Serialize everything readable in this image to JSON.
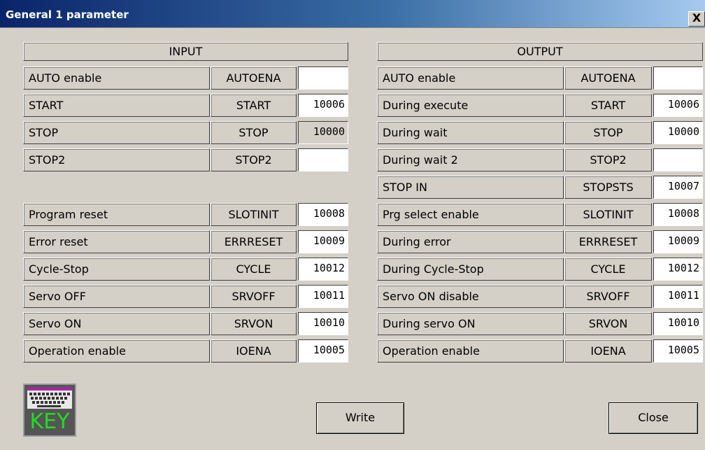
{
  "window": {
    "title": "General 1 parameter",
    "close_glyph": "X"
  },
  "input": {
    "header": "INPUT",
    "rows": [
      {
        "label": "AUTO enable",
        "code": "AUTOENA",
        "value": "",
        "readonly": false
      },
      {
        "label": "START",
        "code": "START",
        "value": "10006",
        "readonly": false
      },
      {
        "label": "STOP",
        "code": "STOP",
        "value": "10000",
        "readonly": true
      },
      {
        "label": "STOP2",
        "code": "STOP2",
        "value": "",
        "readonly": false
      },
      {
        "label": "Program reset",
        "code": "SLOTINIT",
        "value": "10008",
        "readonly": false
      },
      {
        "label": "Error reset",
        "code": "ERRRESET",
        "value": "10009",
        "readonly": false
      },
      {
        "label": "Cycle-Stop",
        "code": "CYCLE",
        "value": "10012",
        "readonly": false
      },
      {
        "label": "Servo OFF",
        "code": "SRVOFF",
        "value": "10011",
        "readonly": false
      },
      {
        "label": "Servo ON",
        "code": "SRVON",
        "value": "10010",
        "readonly": false
      },
      {
        "label": "Operation enable",
        "code": "IOENA",
        "value": "10005",
        "readonly": false
      }
    ]
  },
  "output": {
    "header": "OUTPUT",
    "rows": [
      {
        "label": "AUTO enable",
        "code": "AUTOENA",
        "value": ""
      },
      {
        "label": "During execute",
        "code": "START",
        "value": "10006"
      },
      {
        "label": "During wait",
        "code": "STOP",
        "value": "10000"
      },
      {
        "label": "During wait 2",
        "code": "STOP2",
        "value": ""
      },
      {
        "label": "STOP IN",
        "code": "STOPSTS",
        "value": "10007"
      },
      {
        "label": "Prg select enable",
        "code": "SLOTINIT",
        "value": "10008"
      },
      {
        "label": "During error",
        "code": "ERRRESET",
        "value": "10009"
      },
      {
        "label": "During Cycle-Stop",
        "code": "CYCLE",
        "value": "10012"
      },
      {
        "label": "Servo ON disable",
        "code": "SRVOFF",
        "value": "10011"
      },
      {
        "label": "During servo ON",
        "code": "SRVON",
        "value": "10010"
      },
      {
        "label": "Operation enable",
        "code": "IOENA",
        "value": "10005"
      }
    ]
  },
  "key_button": {
    "text": "KEY",
    "icon": "keyboard-icon",
    "text_color": "#22dd22"
  },
  "buttons": {
    "write_label": "Write",
    "close_label": "Close"
  },
  "colors": {
    "dialog_bg": "#d4d0c8",
    "title_start": "#0a246a",
    "title_end": "#a6caf0"
  }
}
